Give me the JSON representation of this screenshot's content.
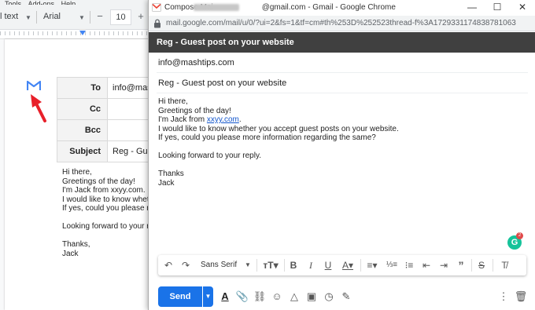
{
  "docs": {
    "menu": [
      "Tools",
      "Add-ons",
      "Help"
    ],
    "toolbar": {
      "style": "l text",
      "font": "Arial",
      "font_size": "10"
    },
    "mail_table": {
      "to_label": "To",
      "to_value": "info@mas",
      "cc_label": "Cc",
      "bcc_label": "Bcc",
      "subject_label": "Subject",
      "subject_value": "Reg - Gue"
    },
    "body_lines": [
      "Hi there,",
      "Greetings of the day!",
      "I'm Jack from xxyy.com.",
      "I would like to know wheth",
      "If yes, could you please m",
      "",
      "Looking forward to your re",
      "",
      "Thanks,",
      "Jack"
    ]
  },
  "chrome": {
    "title_prefix": "Compose Mai",
    "title_suffix": "@gmail.com - Gmail - Google Chrome",
    "url": "mail.google.com/mail/u/0/?ui=2&fs=1&tf=cm#th%253D%252523thread-f%3A1729331174838781063",
    "controls": {
      "minimize": "—",
      "maximize": "☐",
      "close": "✕"
    }
  },
  "compose": {
    "header_title": "Reg - Guest post on your website",
    "to": "info@mashtips.com",
    "subject": "Reg - Guest post on your website",
    "body": {
      "greeting": "Hi there,",
      "line2": "Greetings of the day!",
      "line3_prefix": "I'm Jack from ",
      "line3_link": "xxyy.com",
      "line3_suffix": ".",
      "line4": "I would like to know whether you accept guest posts on your website.",
      "line5": "If yes, could you please more information regarding the same?",
      "line6": "Looking forward to your reply.",
      "line7": "Thanks",
      "line8": "Jack"
    },
    "grammarly_badge": "2",
    "format_font": "Sans Serif",
    "send_label": "Send"
  },
  "colors": {
    "send_blue": "#1a73e8",
    "compose_header": "#404040",
    "grammarly_green": "#15c39a",
    "arrow_red": "#e8202a",
    "gmail_blue": "#4285f4"
  }
}
